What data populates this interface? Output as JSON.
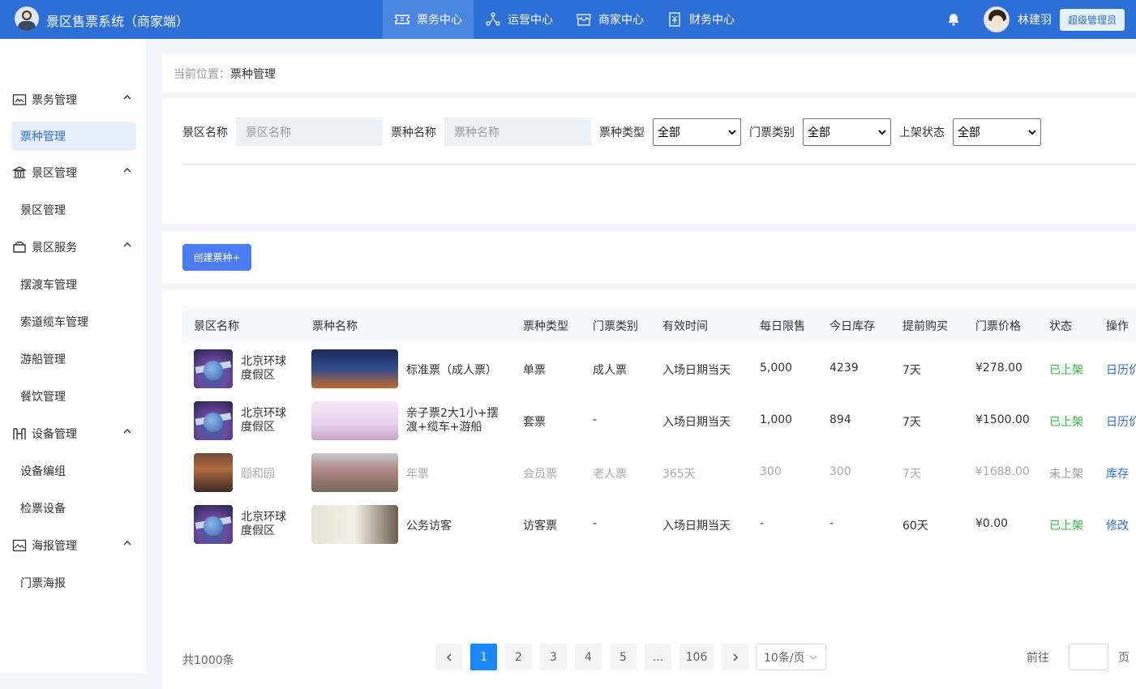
{
  "app": {
    "title": "景区售票系统（商家端）"
  },
  "topnav": [
    {
      "label": "票务中心",
      "icon": "ticket-icon",
      "active": true
    },
    {
      "label": "运营中心",
      "icon": "network-icon",
      "active": false
    },
    {
      "label": "商家中心",
      "icon": "store-icon",
      "active": false
    },
    {
      "label": "财务中心",
      "icon": "finance-icon",
      "active": false
    }
  ],
  "user": {
    "name": "林建羽",
    "role": "超级管理员"
  },
  "sidebar": {
    "groups": [
      {
        "label": "票务管理",
        "icon": "ticket-manage-icon",
        "items": [
          "票种管理"
        ]
      },
      {
        "label": "景区管理",
        "icon": "bank-icon",
        "items": [
          "景区管理"
        ]
      },
      {
        "label": "景区服务",
        "icon": "service-icon",
        "items": [
          "摆渡车管理",
          "索道缆车管理",
          "游船管理",
          "餐饮管理"
        ]
      },
      {
        "label": "设备管理",
        "icon": "device-icon",
        "items": [
          "设备编组",
          "检票设备"
        ]
      },
      {
        "label": "海报管理",
        "icon": "poster-icon",
        "items": [
          "门票海报"
        ]
      }
    ]
  },
  "breadcrumb": {
    "label": "当前位置：",
    "current": "票种管理"
  },
  "filters": {
    "scenic_label": "景区名称",
    "scenic_placeholder": "景区名称",
    "ticket_label": "票种名称",
    "ticket_placeholder": "票种名称",
    "type_label": "票种类型",
    "type_value": "全部",
    "category_label": "门票类别",
    "category_value": "全部",
    "status_label": "上架状态",
    "status_value": "全部"
  },
  "actions": {
    "create": "创建票种+"
  },
  "table": {
    "headers": [
      "景区名称",
      "票种名称",
      "票种类型",
      "门票类别",
      "有效时间",
      "每日限售",
      "今日库存",
      "提前购买",
      "门票价格",
      "状态",
      "操作"
    ],
    "rows": [
      {
        "scenic_line1": "北京环球",
        "scenic_line2": "度假区",
        "ticket_line1": "标准票（成人票）",
        "ticket_line2": "",
        "type": "单票",
        "category": "成人票",
        "valid": "入场日期当天",
        "limit": "5,000",
        "stock": "4239",
        "advance": "7天",
        "price": "¥278.00",
        "status": "已上架",
        "op": "日历价"
      },
      {
        "scenic_line1": "北京环球",
        "scenic_line2": "度假区",
        "ticket_line1": "亲子票2大1小+摆",
        "ticket_line2": "渡+缆车+游船",
        "type": "套票",
        "category": "-",
        "valid": "入场日期当天",
        "limit": "1,000",
        "stock": "894",
        "advance": "7天",
        "price": "¥1500.00",
        "status": "已上架",
        "op": "日历价"
      },
      {
        "scenic_line1": "颐和园",
        "scenic_line2": "",
        "ticket_line1": "年票",
        "ticket_line2": "",
        "type": "会员票",
        "category": "老人票",
        "valid": "365天",
        "limit": "300",
        "stock": "300",
        "advance": "7天",
        "price": "¥1688.00",
        "status": "未上架",
        "op": "库存"
      },
      {
        "scenic_line1": "北京环球",
        "scenic_line2": "度假区",
        "ticket_line1": "公务访客",
        "ticket_line2": "",
        "type": "访客票",
        "category": "-",
        "valid": "入场日期当天",
        "limit": "-",
        "stock": "-",
        "advance": "60天",
        "price": "¥0.00",
        "status": "已上架",
        "op": "修改"
      }
    ]
  },
  "pagination": {
    "total": "共1000条",
    "pages": [
      "1",
      "2",
      "3",
      "4",
      "5",
      "...",
      "106"
    ],
    "active_page": "1",
    "page_size": "10条/页",
    "goto_label": "前往",
    "goto_suffix": "页"
  },
  "colors": {
    "brand": "#2c6fd6",
    "primary_button": "#4c7cf3",
    "status_on": "#2bb53a",
    "active_page": "#1989fa"
  }
}
